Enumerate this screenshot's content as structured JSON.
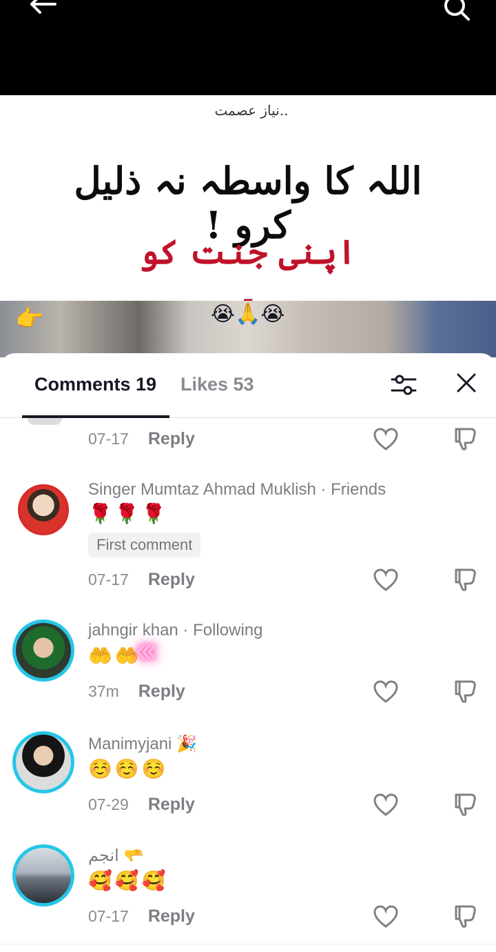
{
  "video": {
    "credit": "نیاز عصمت..",
    "line1": "اللہ کا واسطہ نہ ذلیل کرو !",
    "line2": "اپنی جنت کو ۔",
    "emoji_strip": "😭🙏😭",
    "hand_emoji": "👉"
  },
  "sheet": {
    "tabs": [
      {
        "label": "Comments 19"
      },
      {
        "label": "Likes 53"
      }
    ]
  },
  "comments": [
    {
      "time": "07-17",
      "reply": "Reply"
    },
    {
      "username": "Singer Mumtaz Ahmad Muklish · Friends",
      "text": "🌹🌹🌹",
      "badge": "First comment",
      "time": "07-17",
      "reply": "Reply"
    },
    {
      "username": "jahngir khan · Following",
      "text": "🤲🤲",
      "time": "37m",
      "reply": "Reply"
    },
    {
      "username": "Manimyjani 🎉",
      "text": "☺️☺️☺️",
      "time": "07-29",
      "reply": "Reply"
    },
    {
      "username": "انجم 🫳",
      "text": "🥰🥰🥰",
      "time": "07-17",
      "reply": "Reply"
    }
  ],
  "colors": {
    "accent_ring_friends": "#d92b2b",
    "accent_ring_following": "#25c6e6",
    "like_icon": "#8a8b91"
  }
}
